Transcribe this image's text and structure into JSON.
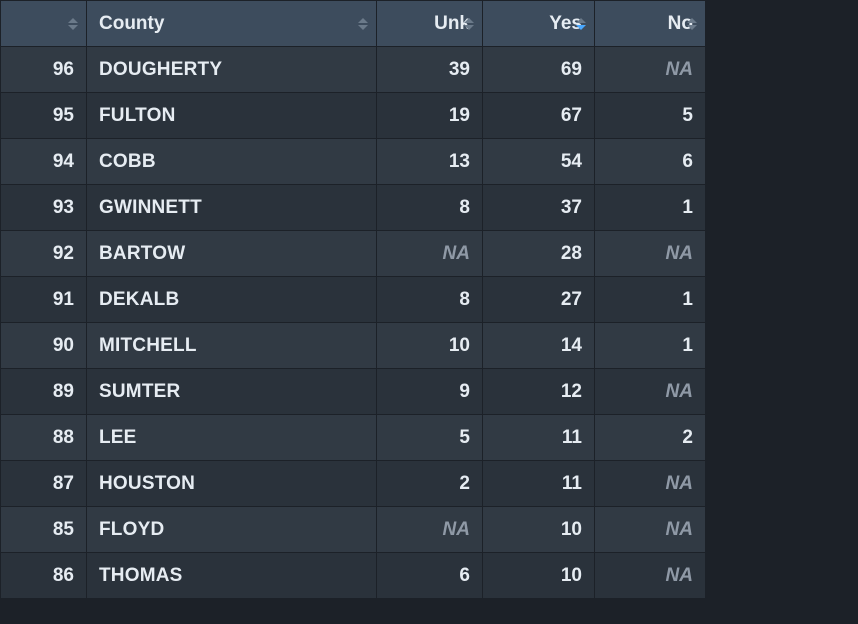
{
  "columns": {
    "idx": {
      "label": ""
    },
    "county": {
      "label": "County"
    },
    "unk": {
      "label": "Unk"
    },
    "yes": {
      "label": "Yes",
      "sorted": "desc"
    },
    "no": {
      "label": "No"
    }
  },
  "na_label": "NA",
  "rows": [
    {
      "idx": "96",
      "county": "DOUGHERTY",
      "unk": "39",
      "yes": "69",
      "no": null
    },
    {
      "idx": "95",
      "county": "FULTON",
      "unk": "19",
      "yes": "67",
      "no": "5"
    },
    {
      "idx": "94",
      "county": "COBB",
      "unk": "13",
      "yes": "54",
      "no": "6"
    },
    {
      "idx": "93",
      "county": "GWINNETT",
      "unk": "8",
      "yes": "37",
      "no": "1"
    },
    {
      "idx": "92",
      "county": "BARTOW",
      "unk": null,
      "yes": "28",
      "no": null
    },
    {
      "idx": "91",
      "county": "DEKALB",
      "unk": "8",
      "yes": "27",
      "no": "1"
    },
    {
      "idx": "90",
      "county": "MITCHELL",
      "unk": "10",
      "yes": "14",
      "no": "1"
    },
    {
      "idx": "89",
      "county": "SUMTER",
      "unk": "9",
      "yes": "12",
      "no": null
    },
    {
      "idx": "88",
      "county": "LEE",
      "unk": "5",
      "yes": "11",
      "no": "2"
    },
    {
      "idx": "87",
      "county": "HOUSTON",
      "unk": "2",
      "yes": "11",
      "no": null
    },
    {
      "idx": "85",
      "county": "FLOYD",
      "unk": null,
      "yes": "10",
      "no": null
    },
    {
      "idx": "86",
      "county": "THOMAS",
      "unk": "6",
      "yes": "10",
      "no": null
    }
  ]
}
